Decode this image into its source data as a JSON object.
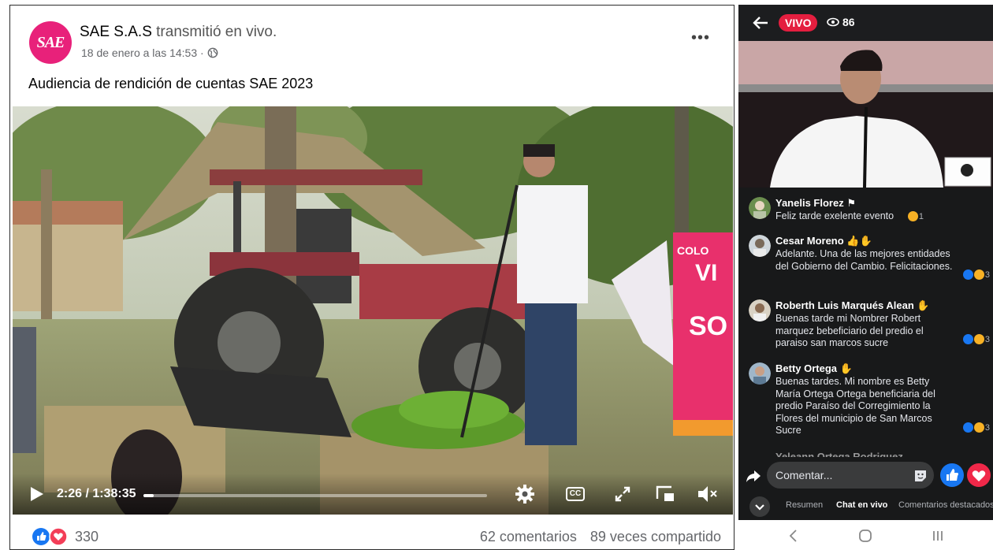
{
  "post": {
    "page_name": "SAE S.A.S",
    "action": "transmitió en vivo.",
    "logo_text": "SAE",
    "date": "18 de enero a las 14:53 ·",
    "more_label": "•••",
    "text": "Audiencia de rendición de cuentas SAE 2023",
    "video": {
      "time": "2:26 / 1:38:35",
      "progress": 0.03,
      "banner_text_1": "COLO",
      "banner_text_2": "VI",
      "banner_text_3": "SO",
      "cc_label": "CC"
    },
    "reaction_count": "330",
    "comments_count": "62 comentarios",
    "shares_count": "89 veces compartido"
  },
  "live": {
    "badge": "VIVO",
    "viewers": "86",
    "comments": [
      {
        "name": "Yanelis Florez",
        "text": "Feliz tarde exelente evento",
        "reactions": "1"
      },
      {
        "name": "Cesar Moreno",
        "text": "Adelante.  Una de las mejores entidades del Gobierno del Cambio. Felicitaciones.",
        "reactions": "3"
      },
      {
        "name": "Roberth Luis Marqués Alean",
        "text": "Buenas tarde mi Nombrer Robert marquez bebeficiario del predio el paraiso san marcos sucre",
        "reactions": "3"
      },
      {
        "name": "Betty Ortega",
        "text": "Buenas tardes. Mi nombre es Betty María Ortega Ortega beneficiaria del predio Paraíso del Corregimiento la Flores del municipio de San Marcos Sucre",
        "reactions": "3"
      },
      {
        "name": "Yeleann Ortega Rodriguez",
        "text": "",
        "reactions": ""
      }
    ],
    "comment_placeholder": "Comentar...",
    "tabs": [
      "Resumen",
      "Chat en vivo",
      "Comentarios destacados"
    ]
  },
  "colors": {
    "brand_pink": "#e8217a",
    "fb_blue": "#1877f2",
    "live_red": "#e41e3f"
  }
}
